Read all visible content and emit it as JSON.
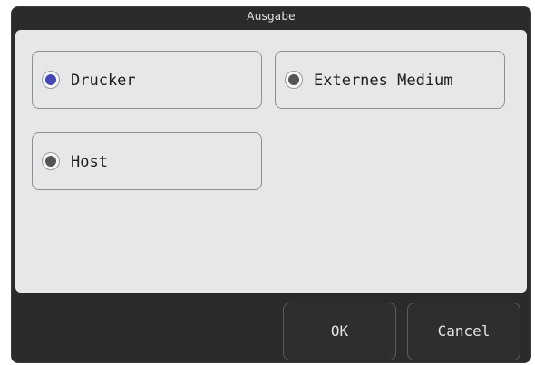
{
  "dialog": {
    "title": "Ausgabe"
  },
  "options": [
    {
      "label": "Drucker",
      "selected": true,
      "icon": "radio-selected-icon"
    },
    {
      "label": "Externes Medium",
      "selected": false,
      "icon": "radio-unselected-icon"
    },
    {
      "label": "Host",
      "selected": false,
      "icon": "radio-unselected-icon"
    }
  ],
  "buttons": {
    "ok_label": "OK",
    "cancel_label": "Cancel"
  },
  "colors": {
    "dialog_background": "#2b2b2b",
    "content_background": "#e6e7e9",
    "radio_selected": "#4548b4",
    "radio_unselected": "#555555"
  }
}
